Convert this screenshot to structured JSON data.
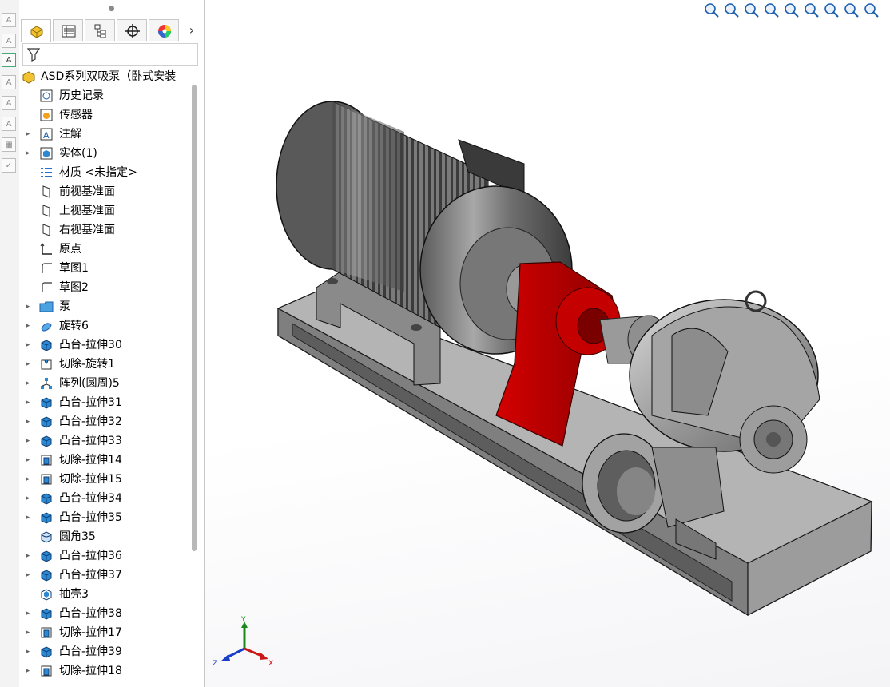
{
  "command_strip": {
    "buttons": [
      "smart-dimension-icon",
      "spell-check-icon",
      "note-icon",
      "format-painter-icon",
      "balloon-icon",
      "auto-balloon-icon",
      "weld-symbol-icon",
      "surface-finish-icon",
      "datum-icon"
    ]
  },
  "tabs": {
    "items": [
      "feature-manager-icon",
      "property-manager-icon",
      "configuration-manager-icon",
      "dimxpert-icon",
      "display-manager-icon"
    ],
    "more": "›"
  },
  "tree": {
    "root_label": "ASD系列双吸泵（卧式安装",
    "items": [
      {
        "label": "历史记录",
        "icon": "history-icon",
        "expandable": false
      },
      {
        "label": "传感器",
        "icon": "sensor-icon",
        "expandable": false
      },
      {
        "label": "注解",
        "icon": "annotation-icon",
        "expandable": true
      },
      {
        "label": "实体(1)",
        "icon": "solid-body-icon",
        "expandable": true
      },
      {
        "label": "材质 <未指定>",
        "icon": "material-icon",
        "expandable": false
      },
      {
        "label": "前视基准面",
        "icon": "plane-icon",
        "expandable": false
      },
      {
        "label": "上视基准面",
        "icon": "plane-icon",
        "expandable": false
      },
      {
        "label": "右视基准面",
        "icon": "plane-icon",
        "expandable": false
      },
      {
        "label": "原点",
        "icon": "origin-icon",
        "expandable": false
      },
      {
        "label": "草图1",
        "icon": "sketch-icon",
        "expandable": false
      },
      {
        "label": "草图2",
        "icon": "sketch-icon",
        "expandable": false
      },
      {
        "label": "泵",
        "icon": "folder-icon",
        "expandable": true
      },
      {
        "label": "旋转6",
        "icon": "revolve-icon",
        "expandable": true
      },
      {
        "label": "凸台-拉伸30",
        "icon": "boss-extrude-icon",
        "expandable": true
      },
      {
        "label": "切除-旋转1",
        "icon": "cut-revolve-icon",
        "expandable": true
      },
      {
        "label": "阵列(圆周)5",
        "icon": "circular-pattern-icon",
        "expandable": true
      },
      {
        "label": "凸台-拉伸31",
        "icon": "boss-extrude-icon",
        "expandable": true
      },
      {
        "label": "凸台-拉伸32",
        "icon": "boss-extrude-icon",
        "expandable": true
      },
      {
        "label": "凸台-拉伸33",
        "icon": "boss-extrude-icon",
        "expandable": true
      },
      {
        "label": "切除-拉伸14",
        "icon": "cut-extrude-icon",
        "expandable": true
      },
      {
        "label": "切除-拉伸15",
        "icon": "cut-extrude-icon",
        "expandable": true
      },
      {
        "label": "凸台-拉伸34",
        "icon": "boss-extrude-icon",
        "expandable": true
      },
      {
        "label": "凸台-拉伸35",
        "icon": "boss-extrude-icon",
        "expandable": true
      },
      {
        "label": "圆角35",
        "icon": "fillet-icon",
        "expandable": false
      },
      {
        "label": "凸台-拉伸36",
        "icon": "boss-extrude-icon",
        "expandable": true
      },
      {
        "label": "凸台-拉伸37",
        "icon": "boss-extrude-icon",
        "expandable": true
      },
      {
        "label": "抽壳3",
        "icon": "shell-icon",
        "expandable": false
      },
      {
        "label": "凸台-拉伸38",
        "icon": "boss-extrude-icon",
        "expandable": true
      },
      {
        "label": "切除-拉伸17",
        "icon": "cut-extrude-icon",
        "expandable": true
      },
      {
        "label": "凸台-拉伸39",
        "icon": "boss-extrude-icon",
        "expandable": true
      },
      {
        "label": "切除-拉伸18",
        "icon": "cut-extrude-icon",
        "expandable": true
      }
    ]
  },
  "view_toolbar": {
    "tools": [
      "zoom-to-fit-icon",
      "zoom-to-area-icon",
      "previous-view-icon",
      "section-view-icon",
      "dynamic-annotation-icon",
      "view-orientation-icon",
      "display-style-icon",
      "dropdown-arrow-icon",
      "display-pane-icon"
    ]
  },
  "triad": {
    "x": "X",
    "y": "Y",
    "z": "Z"
  },
  "colors": {
    "accent_red": "#b50000",
    "model_gray": "#8c8c8c",
    "selection_blue": "#2b6fd1"
  }
}
